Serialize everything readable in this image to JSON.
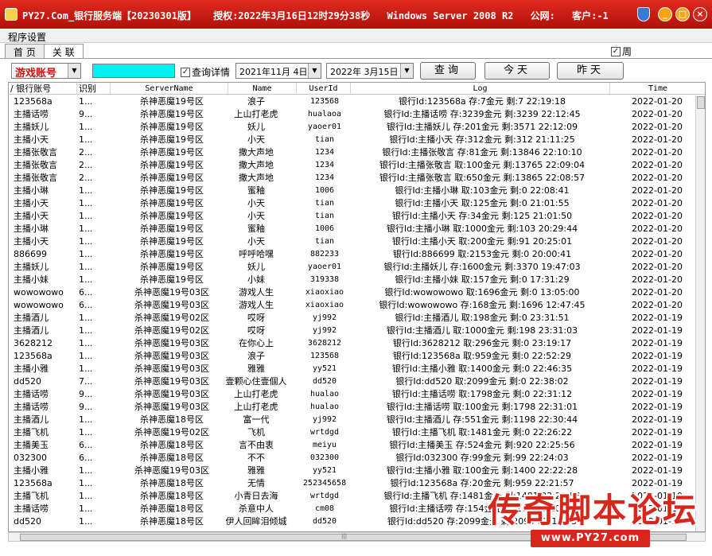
{
  "titlebar": {
    "title_parts": [
      "PY27.Com_银行服务端【20230301版】",
      "授权:2022年3月16日12时29分38秒",
      "Windows Server 2008 R2",
      "公网:",
      "客户:-1"
    ],
    "min_label": "_",
    "max_label": "□",
    "close_label": "×"
  },
  "menu": {
    "settings": "程序设置"
  },
  "tabs": [
    {
      "label": "首 页"
    },
    {
      "label": "关 联"
    }
  ],
  "week_check": {
    "label": "周",
    "checked": true
  },
  "toolbar": {
    "account_type": "游戏账号",
    "detail_check": {
      "label": "查询详情",
      "checked": true
    },
    "date_from": "2021年11月 4日",
    "date_to": "2022年 3月15日",
    "query_label": "查询",
    "today_label": "今天",
    "yesterday_label": "昨天"
  },
  "grid": {
    "headers": [
      "银行账号",
      "识别",
      "ServerName",
      "Name",
      "UserId",
      "Log",
      "Time"
    ],
    "rows": [
      [
        "123568a",
        "1...",
        "杀神恶魔19号区",
        "浪子",
        "123568",
        "银行Id:123568a 存:7金元  剩:7  22:19:18",
        "2022-01-20"
      ],
      [
        "主播话唠",
        "9...",
        "杀神恶魔19号区",
        "上山打老虎",
        "hualaoa",
        "银行Id:主播话唠 存:3239金元  剩:3239  22:12:45",
        "2022-01-20"
      ],
      [
        "主播妖儿",
        "1...",
        "杀神恶魔19号区",
        "妖儿",
        "yaoer01",
        "银行Id:主播妖儿 存:201金元  剩:3571  22:12:09",
        "2022-01-20"
      ],
      [
        "主播小天",
        "1...",
        "杀神恶魔19号区",
        "小天",
        "tian",
        "银行Id:主播小天 存:312金元  剩:312  21:11:25",
        "2022-01-20"
      ],
      [
        "主播张敬言",
        "2...",
        "杀神恶魔19号区",
        "撒大声地",
        "1234",
        "银行Id:主播张敬言 存:81金元  剩:13846  22:10:10",
        "2022-01-20"
      ],
      [
        "主播张敬言",
        "2...",
        "杀神恶魔19号区",
        "撒大声地",
        "1234",
        "银行Id:主播张敬言 取:100金元  剩:13765  22:09:04",
        "2022-01-20"
      ],
      [
        "主播张敬言",
        "2...",
        "杀神恶魔19号区",
        "撒大声地",
        "1234",
        "银行Id:主播张敬言 取:650金元  剩:13865  22:08:57",
        "2022-01-20"
      ],
      [
        "主播小琳",
        "1...",
        "杀神恶魔19号区",
        "蜜釉",
        "1006",
        "银行Id:主播小琳 取:103金元  剩:0  22:08:41",
        "2022-01-20"
      ],
      [
        "主播小天",
        "1...",
        "杀神恶魔19号区",
        "小天",
        "tian",
        "银行Id:主播小天 取:125金元  剩:0  21:01:55",
        "2022-01-20"
      ],
      [
        "主播小天",
        "1...",
        "杀神恶魔19号区",
        "小天",
        "tian",
        "银行Id:主播小天 存:34金元  剩:125  21:01:50",
        "2022-01-20"
      ],
      [
        "主播小琳",
        "1...",
        "杀神恶魔19号区",
        "蜜釉",
        "1006",
        "银行Id:主播小琳 取:1000金元  剩:103  20:29:44",
        "2022-01-20"
      ],
      [
        "主播小天",
        "1...",
        "杀神恶魔19号区",
        "小天",
        "tian",
        "银行Id:主播小天 取:200金元  剩:91  20:25:01",
        "2022-01-20"
      ],
      [
        "886699",
        "1...",
        "杀神恶魔19号区",
        "呼呼哈嘿",
        "882233",
        "银行Id:886699 取:2153金元  剩:0  20:00:41",
        "2022-01-20"
      ],
      [
        "主播妖儿",
        "1...",
        "杀神恶魔19号区",
        "妖儿",
        "yaoer01",
        "银行Id:主播妖儿 存:1600金元  剩:3370  19:47:03",
        "2022-01-20"
      ],
      [
        "主播小妹",
        "1...",
        "杀神恶魔19号区",
        "小妹",
        "319338",
        "银行Id:主播小妹 取:157金元  剩:0  17:31:29",
        "2022-01-20"
      ],
      [
        "wowowowo",
        "6...",
        "杀神恶魔19号03区",
        "游戏人生",
        "xiaoxiao",
        "银行Id:wowowowo 取:1696金元  剩:0  13:05:00",
        "2022-01-20"
      ],
      [
        "wowowowo",
        "6...",
        "杀神恶魔19号03区",
        "游戏人生",
        "xiaoxiao",
        "银行Id:wowowowo 存:168金元  剩:1696  12:47:45",
        "2022-01-20"
      ],
      [
        "主播酒儿",
        "1...",
        "杀神恶魔19号02区",
        "哎呀",
        "yj992",
        "银行Id:主播酒儿 取:198金元  剩:0  23:31:51",
        "2022-01-19"
      ],
      [
        "主播酒儿",
        "1...",
        "杀神恶魔19号02区",
        "哎呀",
        "yj992",
        "银行Id:主播酒儿 取:1000金元  剩:198  23:31:03",
        "2022-01-19"
      ],
      [
        "3628212",
        "1...",
        "杀神恶魔19号03区",
        "在你心上",
        "3628212",
        "银行Id:3628212 取:296金元  剩:0  23:19:17",
        "2022-01-19"
      ],
      [
        "123568a",
        "1...",
        "杀神恶魔19号03区",
        "浪子",
        "123568",
        "银行Id:123568a 取:959金元  剩:0  22:52:29",
        "2022-01-19"
      ],
      [
        "主播小雅",
        "1...",
        "杀神恶魔19号03区",
        "雅雅",
        "yy521",
        "银行Id:主播小雅 取:1400金元  剩:0  22:46:35",
        "2022-01-19"
      ],
      [
        "dd520",
        "7...",
        "杀神恶魔19号03区",
        "壹颗心住壹個人",
        "dd520",
        "银行Id:dd520 取:2099金元  剩:0  22:38:02",
        "2022-01-19"
      ],
      [
        "主播话唠",
        "9...",
        "杀神恶魔19号03区",
        "上山打老虎",
        "hualao",
        "银行Id:主播话唠 取:1798金元  剩:0  22:31:12",
        "2022-01-19"
      ],
      [
        "主播话唠",
        "9...",
        "杀神恶魔19号03区",
        "上山打老虎",
        "hualao",
        "银行Id:主播话唠 取:100金元  剩:1798  22:31:01",
        "2022-01-19"
      ],
      [
        "主播酒儿",
        "1...",
        "杀神恶魔18号区",
        "富一代",
        "yj992",
        "银行Id:主播酒儿 存:551金元  剩:1198  22:30:44",
        "2022-01-19"
      ],
      [
        "主播飞机",
        "1...",
        "杀神恶魔19号02区",
        "飞机",
        "wrtdgd",
        "银行Id:主播飞机 取:1481金元  剩:0  22:26:22",
        "2022-01-19"
      ],
      [
        "主播美玉",
        "6...",
        "杀神恶魔18号区",
        "言不由衷",
        "meiyu",
        "银行Id:主播美玉 存:524金元  剩:920  22:25:56",
        "2022-01-19"
      ],
      [
        "032300",
        "6...",
        "杀神恶魔18号区",
        "不不",
        "032300",
        "银行Id:032300 存:99金元  剩:99  22:24:03",
        "2022-01-19"
      ],
      [
        "主播小雅",
        "1...",
        "杀神恶魔19号03区",
        "雅雅",
        "yy521",
        "银行Id:主播小雅 取:100金元  剩:1400  22:22:28",
        "2022-01-19"
      ],
      [
        "123568a",
        "1...",
        "杀神恶魔18号区",
        "无情",
        "252345658",
        "银行Id:123568a 存:20金元  剩:959  22:21:57",
        "2022-01-19"
      ],
      [
        "主播飞机",
        "1...",
        "杀神恶魔18号区",
        "小青日去海",
        "wrtdgd",
        "银行Id:主播飞机 存:1481金元  剩:1481  22:20:58",
        "2022-01-19"
      ],
      [
        "主播话唠",
        "1...",
        "杀神恶魔18号区",
        "杀意中人",
        "cm08",
        "银行Id:主播话唠 存:154金元  剩:154  22:20:10",
        "2022-01-19"
      ],
      [
        "dd520",
        "1...",
        "杀神恶魔18号区",
        "伊人回眸泪倾城",
        "dd520",
        "银行Id:dd520 存:2099金元  剩:2099  22:19:33",
        "2022-01-19"
      ]
    ]
  },
  "watermark": {
    "big": "传奇脚本论坛",
    "url": "www.PY27.com"
  }
}
